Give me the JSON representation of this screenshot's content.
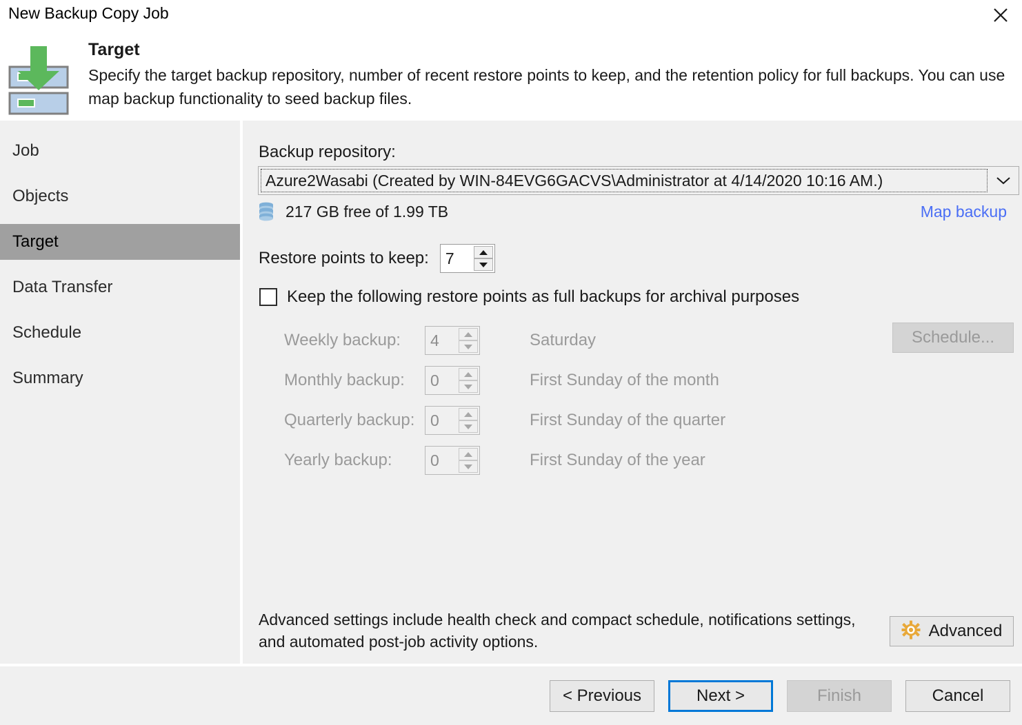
{
  "window": {
    "title": "New Backup Copy Job",
    "close_icon": "close-icon"
  },
  "header": {
    "icon": "backup-target-download-icon",
    "title": "Target",
    "description": "Specify the target backup repository, number of recent restore points to keep, and the retention policy for full backups. You can use map backup functionality to seed backup files."
  },
  "sidebar": {
    "items": [
      {
        "label": "Job",
        "active": false
      },
      {
        "label": "Objects",
        "active": false
      },
      {
        "label": "Target",
        "active": true
      },
      {
        "label": "Data Transfer",
        "active": false
      },
      {
        "label": "Schedule",
        "active": false
      },
      {
        "label": "Summary",
        "active": false
      }
    ]
  },
  "content": {
    "repository": {
      "label": "Backup repository:",
      "selected": "Azure2Wasabi (Created by WIN-84EVG6GACVS\\Administrator at 4/14/2020 10:16 AM.)",
      "dropdown_icon": "chevron-down-icon",
      "free_space_icon": "database-icon",
      "free_space": "217 GB free of 1.99 TB",
      "map_backup_link": "Map backup"
    },
    "restore_points": {
      "label": "Restore points to keep:",
      "value": "7"
    },
    "archival": {
      "checkbox_label": "Keep the following restore points as full backups for archival purposes",
      "checked": false,
      "rows": [
        {
          "label": "Weekly backup:",
          "value": "4",
          "description": "Saturday"
        },
        {
          "label": "Monthly backup:",
          "value": "0",
          "description": "First Sunday of the month"
        },
        {
          "label": "Quarterly backup:",
          "value": "0",
          "description": "First Sunday of the quarter"
        },
        {
          "label": "Yearly backup:",
          "value": "0",
          "description": "First Sunday of the year"
        }
      ],
      "schedule_button": "Schedule..."
    },
    "advanced": {
      "description": "Advanced settings include health check and compact schedule, notifications settings, and automated post-job activity options.",
      "button_label": "Advanced",
      "button_icon": "gear-icon"
    }
  },
  "footer": {
    "previous": "< Previous",
    "next": "Next >",
    "finish": "Finish",
    "cancel": "Cancel"
  },
  "colors": {
    "accent_blue": "#0078d7",
    "link_blue": "#4a6ef5",
    "body_bg": "#f0f0f0",
    "active_item": "#a0a0a0",
    "gear_gold": "#e8a838",
    "icon_green": "#5cb85c",
    "icon_blue": "#b8cfe8"
  }
}
